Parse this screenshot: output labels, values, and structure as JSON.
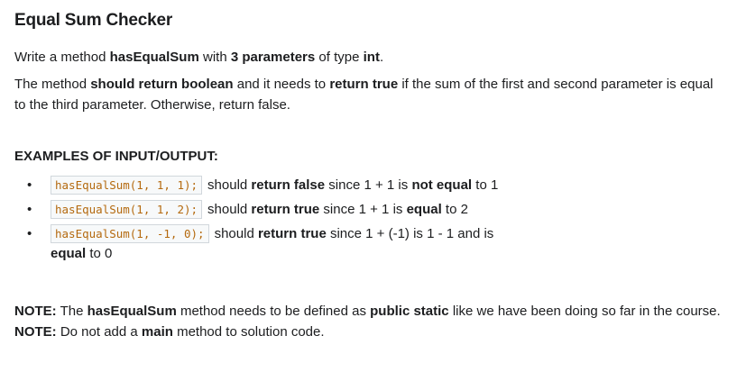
{
  "title": "Equal Sum Checker",
  "intro": {
    "p1_a": "Write a method ",
    "p1_b": "hasEqualSum",
    "p1_c": " with ",
    "p1_d": "3 parameters",
    "p1_e": " of type ",
    "p1_f": "int",
    "p1_g": ".",
    "p2_a": "The method ",
    "p2_b": "should return boolean",
    "p2_c": " and it needs to ",
    "p2_d": "return true",
    "p2_e": " if the sum of the first and second parameter is equal to the third parameter. Otherwise, return false."
  },
  "examples_heading": "EXAMPLES OF INPUT/OUTPUT:",
  "examples": [
    {
      "code": "hasEqualSum(1, 1, 1);",
      "a": "should ",
      "b": "return false",
      "c": " since 1 + 1 is ",
      "d": "not equal",
      "e": " to 1"
    },
    {
      "code": "hasEqualSum(1, 1, 2);",
      "a": "should ",
      "b": "return true",
      "c": " since 1 + 1 is ",
      "d": "equal",
      "e": " to 2"
    },
    {
      "code": "hasEqualSum(1, -1, 0);",
      "a": "should ",
      "b": "return true",
      "c": " since 1 + (-1) is 1 - 1 and is ",
      "d": "equal",
      "e": " to 0"
    }
  ],
  "notes": {
    "n1_label": "NOTE:",
    "n1_a": " The ",
    "n1_b": "hasEqualSum",
    "n1_c": " method  needs to be defined as ",
    "n1_d": "public static",
    "n1_e": " like we have been doing so far in the course.",
    "n2_label": "NOTE:",
    "n2_a": " Do not add a  ",
    "n2_b": "main",
    "n2_c": " method to solution code."
  },
  "colors": {
    "text": "#1c1d1f",
    "code_text": "#b4690e",
    "code_border": "#d1d7dc"
  }
}
